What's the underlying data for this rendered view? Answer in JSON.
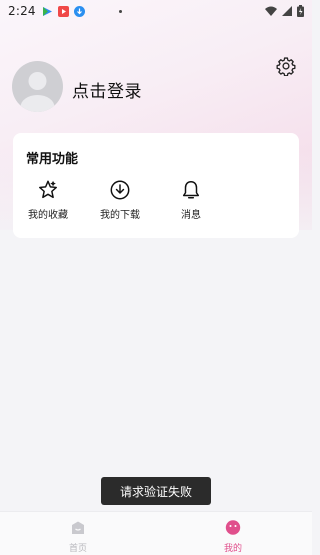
{
  "status_bar": {
    "time": "2:24",
    "icons": [
      "play-store-icon",
      "video-app-icon",
      "download-app-icon",
      "notification-dot",
      "wifi-icon",
      "signal-icon",
      "battery-icon"
    ]
  },
  "header": {
    "login_text": "点击登录",
    "settings_icon": "gear-icon",
    "avatar_icon": "default-avatar-icon"
  },
  "functions_card": {
    "title": "常用功能",
    "items": [
      {
        "label": "我的收藏",
        "icon": "star-icon"
      },
      {
        "label": "我的下载",
        "icon": "download-icon"
      },
      {
        "label": "消息",
        "icon": "bell-icon"
      }
    ]
  },
  "toast": {
    "text": "请求验证失败"
  },
  "tab_bar": {
    "tabs": [
      {
        "label": "首页",
        "icon": "home-icon",
        "active": false
      },
      {
        "label": "我的",
        "icon": "profile-face-icon",
        "active": true
      }
    ]
  },
  "colors": {
    "accent_pink": "#e04f8c",
    "tab_inactive": "#b8b8bd",
    "toast_bg": "#2b2b2b"
  }
}
